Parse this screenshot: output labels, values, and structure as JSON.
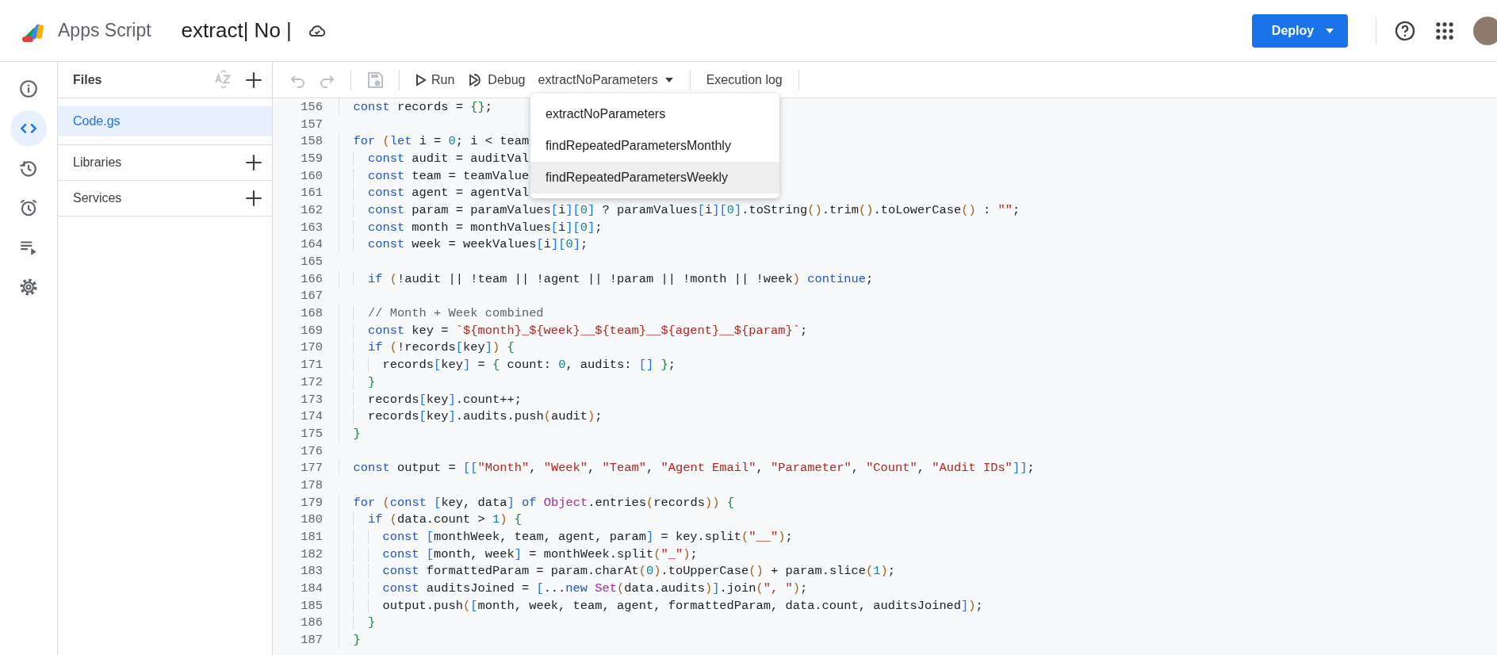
{
  "header": {
    "app_name": "Apps Script",
    "project_title": "extract| No |",
    "deploy_button": "Deploy"
  },
  "rail": [
    {
      "kind": "info",
      "selected": false
    },
    {
      "kind": "code",
      "selected": true
    },
    {
      "kind": "history",
      "selected": false
    },
    {
      "kind": "triggers",
      "selected": false
    },
    {
      "kind": "executions",
      "selected": false
    },
    {
      "kind": "settings",
      "selected": false
    }
  ],
  "files_panel": {
    "title": "Files",
    "files": [
      {
        "name": "Code.gs",
        "selected": true
      }
    ],
    "sections": [
      "Libraries",
      "Services"
    ]
  },
  "toolbar": {
    "run": "Run",
    "debug": "Debug",
    "function_select": "extractNoParameters",
    "execution_log": "Execution log"
  },
  "function_menu": [
    {
      "label": "extractNoParameters",
      "hovered": false
    },
    {
      "label": "findRepeatedParametersMonthly",
      "hovered": false
    },
    {
      "label": "findRepeatedParametersWeekly",
      "hovered": true
    }
  ],
  "editor": {
    "lines": [
      {
        "number": "156",
        "code": "  const records = {};"
      },
      {
        "number": "157"
      },
      {
        "number": "158",
        "code": "  for (let i = 0; i < team"
      },
      {
        "number": "159",
        "code": "    const audit = auditVal"
      },
      {
        "number": "160",
        "code": "    const team = teamValue"
      },
      {
        "number": "161",
        "code": "    const agent = agentVal"
      },
      {
        "number": "162",
        "code": "    const param = paramValues[i][0] ? paramValues[i][0].toString().trim().toLowerCase() : \"\";"
      },
      {
        "number": "163",
        "code": "    const month = monthValues[i][0];"
      },
      {
        "number": "164",
        "code": "    const week = weekValues[i][0];"
      },
      {
        "number": "165"
      },
      {
        "number": "166",
        "code": "    if (!audit || !team || !agent || !param || !month || !week) continue;"
      },
      {
        "number": "167"
      },
      {
        "number": "168",
        "code": "    // Month + Week combined"
      },
      {
        "number": "169",
        "code": "    const key = `${month}_${week}__${team}__${agent}__${param}`;"
      },
      {
        "number": "170",
        "code": "    if (!records[key]) {"
      },
      {
        "number": "171",
        "code": "      records[key] = { count: 0, audits: [] };"
      },
      {
        "number": "172",
        "code": "    }"
      },
      {
        "number": "173",
        "code": "    records[key].count++;"
      },
      {
        "number": "174",
        "code": "    records[key].audits.push(audit);"
      },
      {
        "number": "175",
        "code": "  }"
      },
      {
        "number": "176"
      },
      {
        "number": "177",
        "code": "  const output = [[\"Month\", \"Week\", \"Team\", \"Agent Email\", \"Parameter\", \"Count\", \"Audit IDs\"]];"
      },
      {
        "number": "178"
      },
      {
        "number": "179",
        "code": "  for (const [key, data] of Object.entries(records)) {"
      },
      {
        "number": "180",
        "code": "    if (data.count > 1) {"
      },
      {
        "number": "181",
        "code": "      const [monthWeek, team, agent, param] = key.split(\"__\");"
      },
      {
        "number": "182",
        "code": "      const [month, week] = monthWeek.split(\"_\");"
      },
      {
        "number": "183",
        "code": "      const formattedParam = param.charAt(0).toUpperCase() + param.slice(1);"
      },
      {
        "number": "184",
        "code": "      const auditsJoined = [...new Set(data.audits)].join(\", \");"
      },
      {
        "number": "185",
        "code": "      output.push([month, week, team, agent, formattedParam, data.count, auditsJoined]);"
      },
      {
        "number": "186",
        "code": "    }"
      },
      {
        "number": "187",
        "code": "  }"
      }
    ]
  }
}
